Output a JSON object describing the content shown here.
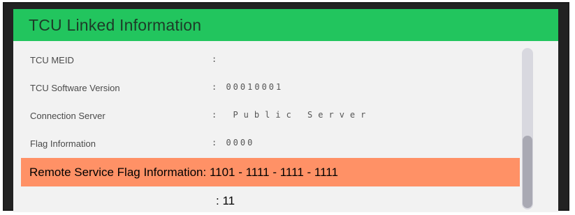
{
  "header": {
    "title": "TCU Linked Information"
  },
  "rows": [
    {
      "label": "TCU MEID",
      "value": ":"
    },
    {
      "label": "TCU Software Version",
      "value": ": 00010001"
    },
    {
      "label": "Connection Server",
      "value": ": Public Server"
    },
    {
      "label": "Flag Information",
      "value": ": 0000"
    }
  ],
  "highlight": {
    "text": "Remote Service Flag Information: 1101 - 1111 - 1111 - 1111"
  },
  "extra": {
    "value": ": 11"
  },
  "colors": {
    "header": "#22c55e",
    "highlight": "#ff9166",
    "content_bg": "#f2f2f2"
  }
}
